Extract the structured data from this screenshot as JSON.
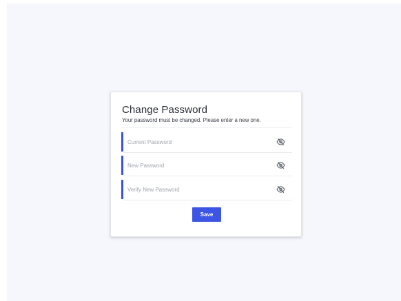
{
  "page": {
    "title": "Change Password",
    "subtitle": "Your password must be changed. Please enter a new one."
  },
  "fields": [
    {
      "placeholder": "Current Password",
      "value": "",
      "icon": "eye-slash-icon"
    },
    {
      "placeholder": "New Password",
      "value": "",
      "icon": "eye-slash-icon"
    },
    {
      "placeholder": "Verify New Password",
      "value": "",
      "icon": "eye-slash-icon"
    }
  ],
  "actions": {
    "save_label": "Save"
  },
  "colors": {
    "accent": "#3d55e5",
    "background": "#f6f7fc",
    "card": "#ffffff"
  }
}
